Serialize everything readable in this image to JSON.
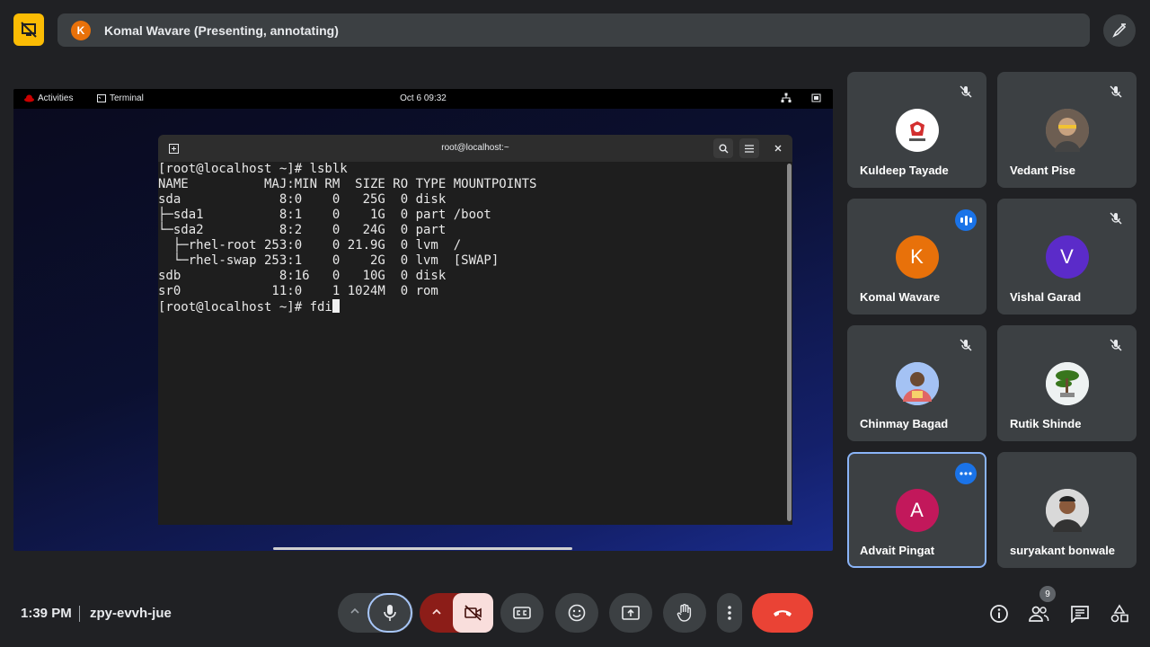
{
  "header": {
    "presenter_initial": "K",
    "presenting_text": "Komal Wavare (Presenting, annotating)"
  },
  "shared_screen": {
    "activities_label": "Activities",
    "app_label": "Terminal",
    "clock": "Oct 6  09:32",
    "terminal_title": "root@localhost:~",
    "terminal_lines": [
      "[root@localhost ~]# lsblk",
      "NAME          MAJ:MIN RM  SIZE RO TYPE MOUNTPOINTS",
      "sda             8:0    0   25G  0 disk",
      "├─sda1          8:1    0    1G  0 part /boot",
      "└─sda2          8:2    0   24G  0 part",
      "  ├─rhel-root 253:0    0 21.9G  0 lvm  /",
      "  └─rhel-swap 253:1    0    2G  0 lvm  [SWAP]",
      "sdb             8:16   0   10G  0 disk",
      "sr0            11:0    1 1024M  0 rom"
    ],
    "prompt_line": "[root@localhost ~]# fdi"
  },
  "participants": [
    {
      "name": "Kuldeep Tayade",
      "avatar_type": "logo",
      "state": "muted"
    },
    {
      "name": "Vedant Pise",
      "avatar_type": "photo",
      "state": "muted"
    },
    {
      "name": "Komal Wavare",
      "initial": "K",
      "avatar_color": "#e8710a",
      "state": "speaking"
    },
    {
      "name": "Vishal Garad",
      "initial": "V",
      "avatar_color": "#5b2bc9",
      "state": "muted"
    },
    {
      "name": "Chinmay Bagad",
      "avatar_type": "photo",
      "state": "muted"
    },
    {
      "name": "Rutik Shinde",
      "avatar_type": "photo",
      "state": "muted"
    },
    {
      "name": "Advait Pingat",
      "initial": "A",
      "avatar_color": "#c2185b",
      "state": "options"
    },
    {
      "name": "suryakant bonwale",
      "avatar_type": "photo",
      "state": "none"
    }
  ],
  "footer": {
    "time": "1:39 PM",
    "meeting_code": "zpy-evvh-jue",
    "people_count": "9"
  },
  "colors": {
    "background": "#202124",
    "tile": "#3c4043",
    "hangup": "#ea4335",
    "presenting_yellow": "#fbbc04",
    "accent_blue": "#8ab4f8"
  }
}
